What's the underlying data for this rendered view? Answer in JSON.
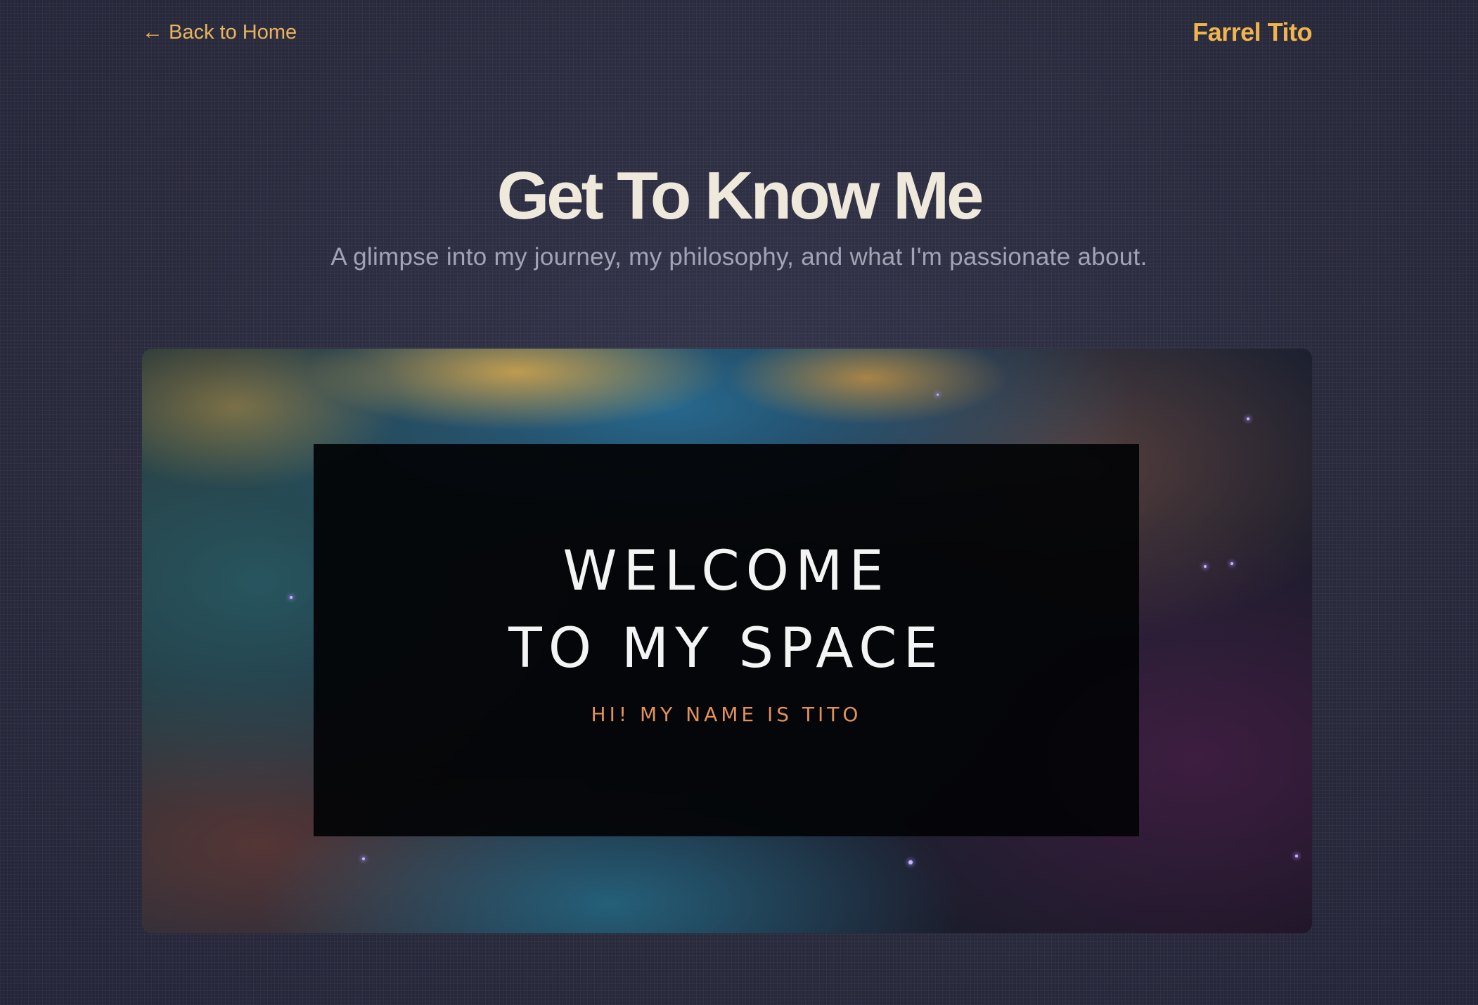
{
  "header": {
    "back_arrow": "←",
    "back_label": "Back to Home",
    "brand": "Farrel Tito"
  },
  "hero": {
    "title": "Get To Know Me",
    "subtitle": "A glimpse into my journey, my philosophy, and what I'm passionate about."
  },
  "banner": {
    "welcome_line1": "WELCOME",
    "welcome_line2": "TO MY SPACE",
    "greeting": "HI! MY NAME IS TITO"
  },
  "colors": {
    "accent": "#f0b44e",
    "background": "#2b2b3f",
    "title": "#efe9dc",
    "subtitle": "#a3a3b6",
    "greeting": "#e39158"
  },
  "icons": {
    "back": "left-arrow-icon"
  }
}
